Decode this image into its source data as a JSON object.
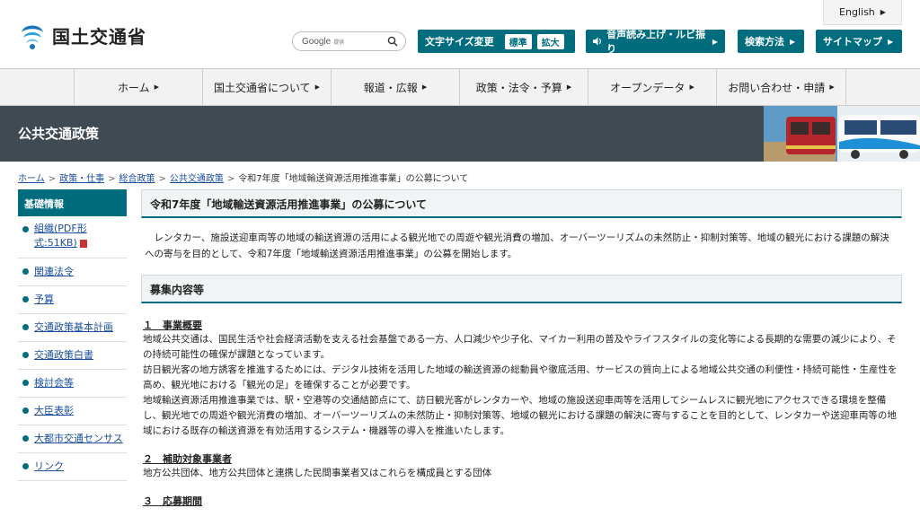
{
  "header": {
    "logo_text": "国土交通省",
    "search_brand": "Google",
    "search_sub": "提供",
    "font_size_label": "文字サイズ変更",
    "font_size_standard": "標準",
    "font_size_large": "拡大",
    "read_aloud": "音声読み上げ・ルビ振り",
    "search_method": "検索方法",
    "sitemap": "サイトマップ",
    "english": "English"
  },
  "gnav": [
    "ホーム",
    "国土交通省について",
    "報道・広報",
    "政策・法令・予算",
    "オープンデータ",
    "お問い合わせ・申請"
  ],
  "banner": {
    "title": "公共交通政策"
  },
  "breadcrumb": {
    "items": [
      "ホーム",
      "政策・仕事",
      "総合政策",
      "公共交通政策"
    ],
    "current": "令和7年度「地域輸送資源活用推進事業」の公募について"
  },
  "sidebar": {
    "heading": "基礎情報",
    "items": [
      "組織(PDF形式:51KB)",
      "関連法令",
      "予算",
      "交通政策基本計画",
      "交通政策白書",
      "検討会等",
      "大臣表彰",
      "大都市交通センサス",
      "リンク"
    ]
  },
  "main": {
    "title": "令和7年度「地域輸送資源活用推進事業」の公募について",
    "lead": "レンタカー、施設送迎車両等の地域の輸送資源の活用による観光地での周遊や観光消費の増加、オーバーツーリズムの未然防止・抑制対策等、地域の観光における課題の解決への寄与を目的として、令和7年度「地域輸送資源活用推進事業」の公募を開始します。",
    "section_title": "募集内容等",
    "s1_title": "１　事業概要",
    "s1_p1": "地域公共交通は、国民生活や社会経済活動を支える社会基盤である一方、人口減少や少子化、マイカー利用の普及やライフスタイルの変化等による長期的な需要の減少により、その持続可能性の確保が課題となっています。",
    "s1_p2": "訪日観光客の地方誘客を推進するためには、デジタル技術を活用した地域の輸送資源の総動員や徹底活用、サービスの質向上による地域公共交通の利便性・持続可能性・生産性を高め、観光地における「観光の足」を確保することが必要です。",
    "s1_p3": "地域輸送資源活用推進事業では、駅・空港等の交通結節点にて、訪日観光客がレンタカーや、地域の施設送迎車両等を活用してシームレスに観光地にアクセスできる環境を整備し、観光地での周遊や観光消費の増加、オーバーツーリズムの未然防止・抑制対策等、地域の観光における課題の解決に寄与することを目的として、レンタカーや送迎車両等の地域における既存の輸送資源を有効活用するシステム・機器等の導入を推進いたします。",
    "s2_title": "２　補助対象事業者",
    "s2_p1": "地方公共団体、地方公共団体と連携した民間事業者又はこれらを構成員とする団体",
    "s3_title": "３　応募期間"
  },
  "colors": {
    "accent": "#006d7e",
    "banner": "#3f4a52",
    "link": "#1a4fa0"
  }
}
